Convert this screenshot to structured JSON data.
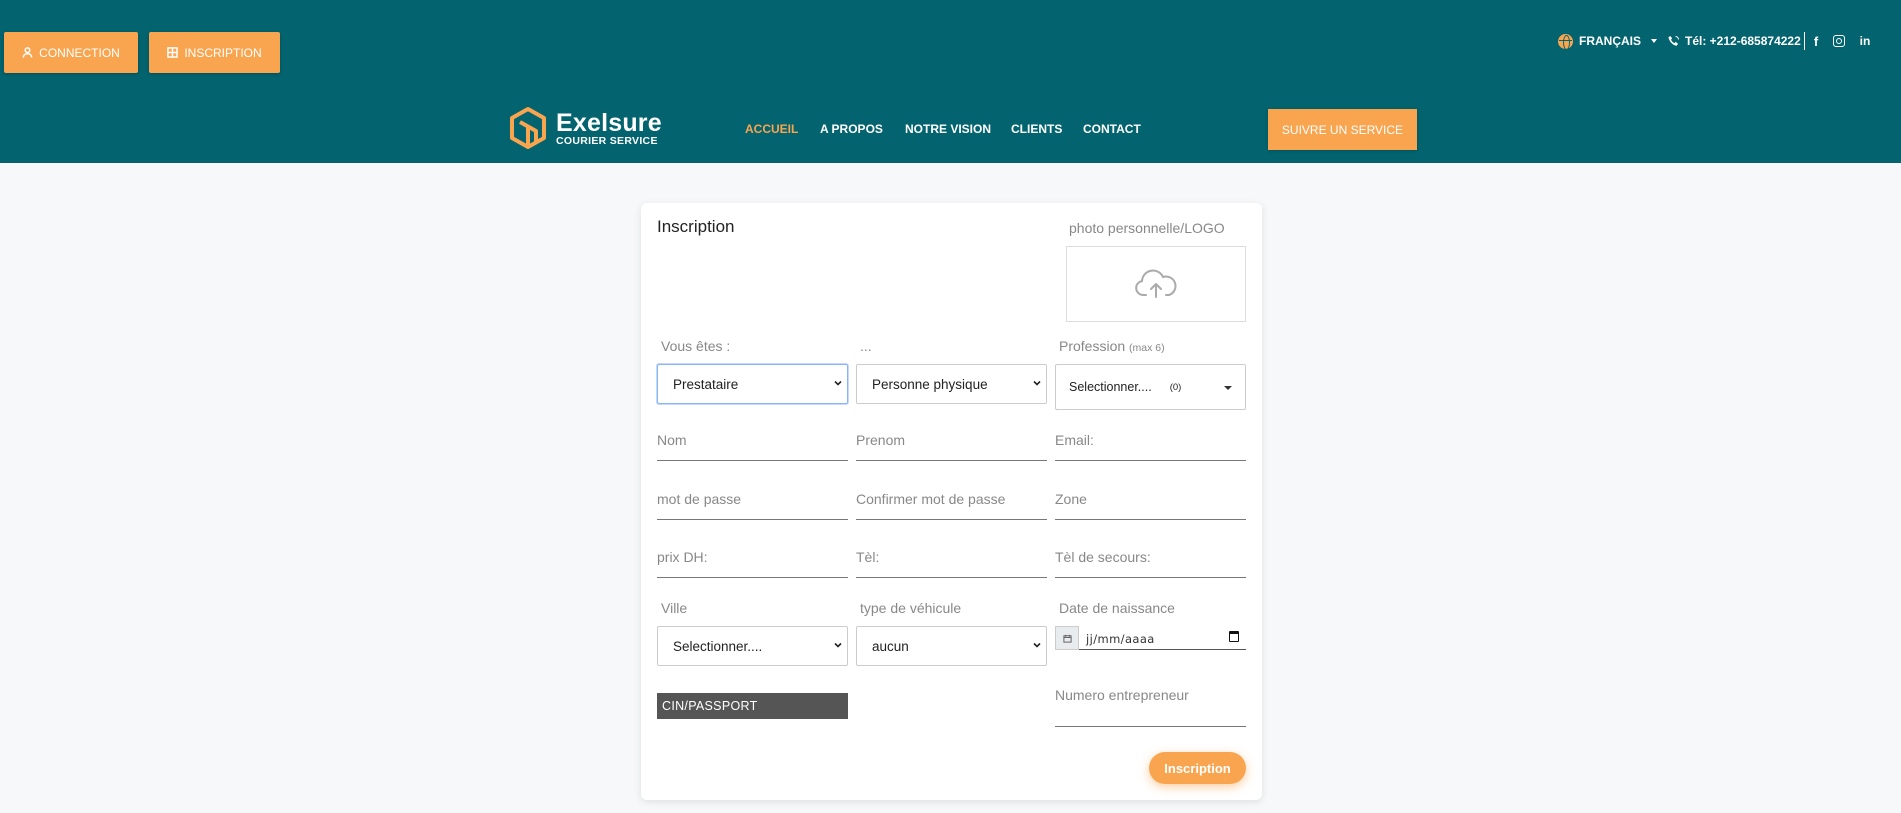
{
  "topbar": {
    "connection_label": "CONNECTION",
    "inscription_label": "INSCRIPTION",
    "language": "FRANÇAIS",
    "phone": "Tél: +212-685874222",
    "accent_color": "#f9a550",
    "bg_color": "#03636e"
  },
  "brand": {
    "name": "Exelsure",
    "tagline": "COURIER SERVICE"
  },
  "nav": {
    "items": [
      "ACCUEIL",
      "A PROPOS",
      "NOTRE VISION",
      "CLIENTS",
      "CONTACT"
    ],
    "active_index": 0,
    "cta": "SUIVRE UN SERVICE"
  },
  "form": {
    "title": "Inscription",
    "photo_label": "photo personnelle/LOGO",
    "type_label": "Vous êtes :",
    "type_value": "Prestataire",
    "subtype_label": "...",
    "subtype_value": "Personne physique",
    "profession_label": "Profession",
    "profession_hint": "(max 6)",
    "profession_value": "Selectionner....",
    "profession_count": "(0)",
    "nom": "Nom",
    "prenom": "Prenom",
    "email": "Email:",
    "password": "mot de passe",
    "confirm_password": "Confirmer mot de passe",
    "zone": "Zone",
    "prix": "prix DH:",
    "tel": "Tèl:",
    "tel_secours": "Tèl de secours:",
    "ville_label": "Ville",
    "ville_value": "Selectionner....",
    "vehicule_label": "type de véhicule",
    "vehicule_value": "aucun",
    "naissance_label": "Date de naissance",
    "naissance_placeholder": "jj/mm/aaaa",
    "cin_label": "CIN/PASSPORT",
    "entrepreneur": "Numero entrepreneur",
    "submit_label": "Inscription"
  }
}
